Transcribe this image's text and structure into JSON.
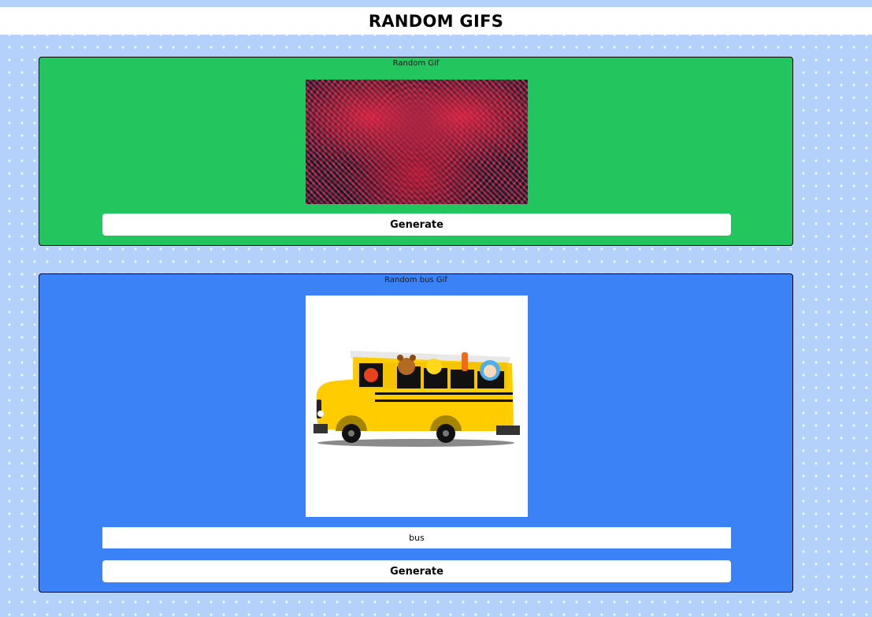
{
  "header": {
    "title": "RANDOM GIFS"
  },
  "random_card": {
    "title": "Random Gif",
    "gif_alt": "psychedelic-abstract-gif",
    "generate_label": "Generate",
    "color": "#22c55e"
  },
  "tag_card": {
    "title": "Random bus Gif",
    "gif_alt": "cartoon-school-bus-gif",
    "tag_value": "bus",
    "generate_label": "Generate",
    "color": "#3b82f6"
  },
  "colors": {
    "background": "#b3d1fb",
    "header_bg": "#ffffff",
    "bus_yellow": "#ffcc00"
  }
}
